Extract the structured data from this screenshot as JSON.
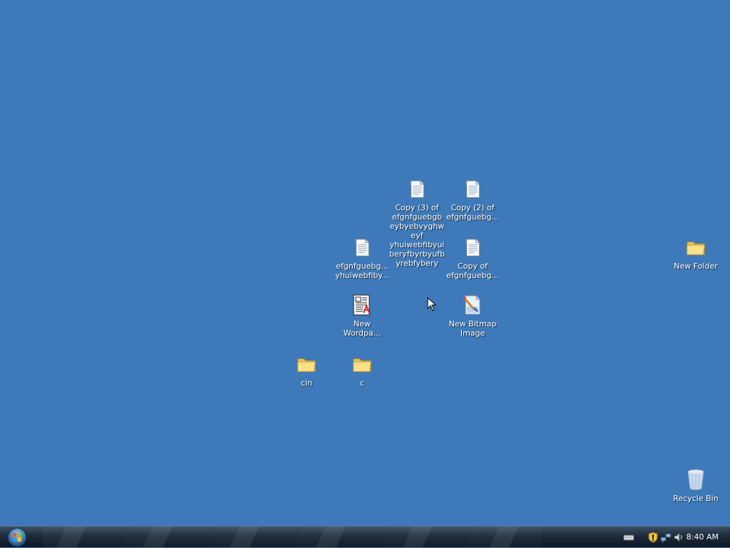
{
  "desktop": {
    "background_color": "#3e7ab9",
    "icons": {
      "copy3": {
        "label": "Copy (3) of\nefgnfguebgb\neybyebvyghw\neyf\nyhuiwebfibyui\nberyfbyrbyufb\nyrebfybery",
        "icon": "text-document-icon"
      },
      "copy2": {
        "label": "Copy (2) of\nefgnfguebg...",
        "icon": "text-document-icon"
      },
      "efgn": {
        "label": "efgnfguebg...\nyhuiwebfiby...",
        "icon": "text-document-icon"
      },
      "copy1": {
        "label": "Copy of\nefgnfguebg...",
        "icon": "text-document-icon"
      },
      "wordpad": {
        "label": "New\nWordpa...",
        "icon": "wordpad-document-icon"
      },
      "bitmap": {
        "label": "New Bitmap\nImage",
        "icon": "bitmap-image-icon"
      },
      "cin": {
        "label": "cin",
        "icon": "folder-icon"
      },
      "c": {
        "label": "c",
        "icon": "folder-icon"
      },
      "new_folder": {
        "label": "New Folder",
        "icon": "folder-icon"
      },
      "recycle_bin": {
        "label": "Recycle Bin",
        "icon": "recycle-bin-icon"
      }
    }
  },
  "taskbar": {
    "start_icon": "windows-start-orb-icon",
    "tray_icons": [
      "keyboard-icon",
      "security-shield-icon",
      "network-icon",
      "volume-icon"
    ],
    "clock": "8:40 AM"
  }
}
